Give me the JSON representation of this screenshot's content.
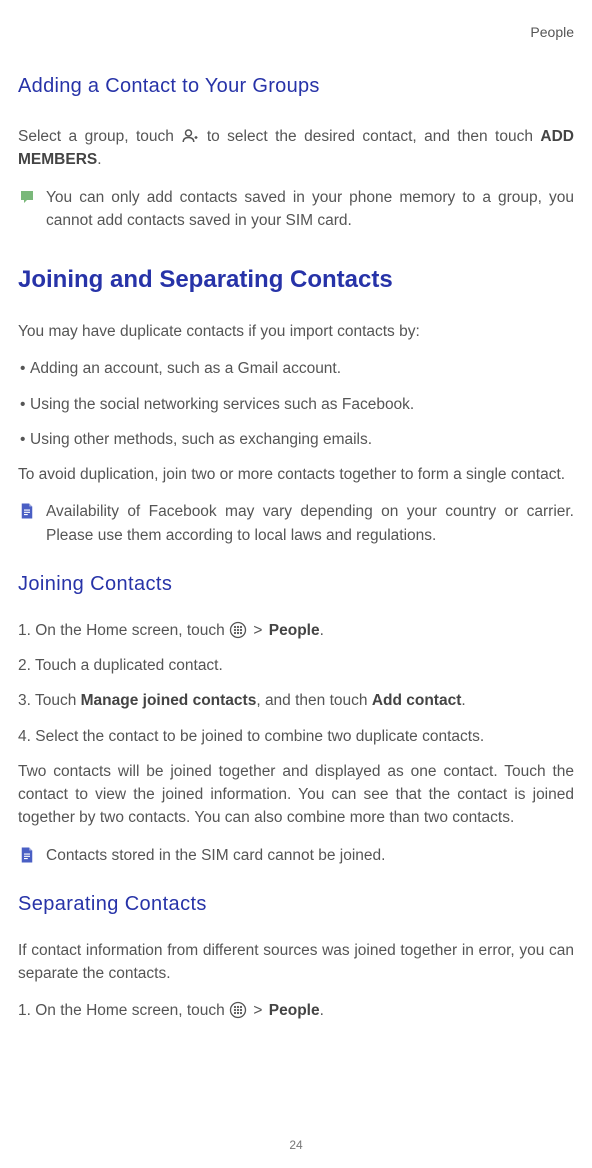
{
  "header": {
    "chapter": "People"
  },
  "section1": {
    "title": "Adding a Contact to Your Groups",
    "para1_a": "Select a group, touch ",
    "para1_b": " to select the desired contact, and then touch ",
    "para1_bold": "ADD MEMBERS",
    "para1_c": ".",
    "note1": "You can only add contacts saved in your phone memory to a group, you cannot add contacts saved in your SIM card."
  },
  "section2": {
    "title": "Joining and Separating Contacts",
    "intro": "You may have duplicate contacts if you import contacts by:",
    "bullets": [
      "Adding an account, such as a Gmail account.",
      "Using the social networking services such as Facebook.",
      "Using other methods, such as exchanging emails."
    ],
    "para2": "To avoid duplication, join two or more contacts together to form a single contact.",
    "note2": "Availability of Facebook may vary depending on your country or carrier. Please use them according to local laws and regulations."
  },
  "section3": {
    "title": "Joining Contacts",
    "step1_a": "On the Home screen, touch ",
    "step1_b": " > ",
    "step1_bold": "People",
    "step1_c": ".",
    "step2": "Touch a duplicated contact.",
    "step3_a": "Touch ",
    "step3_bold1": "Manage joined contacts",
    "step3_b": ", and then touch ",
    "step3_bold2": "Add contact",
    "step3_c": ".",
    "step4": "Select the contact to be joined to combine two duplicate contacts.",
    "para3": "Two contacts will be joined together and displayed as one contact. Touch the contact to view the joined information. You can see that the contact is joined together by two contacts. You can also combine more than two contacts.",
    "note3": "Contacts stored in the SIM card cannot be joined."
  },
  "section4": {
    "title": "Separating Contacts",
    "para4": "If contact information from different sources was joined together in error, you can separate the contacts.",
    "step1_a": "On the Home screen, touch ",
    "step1_b": " > ",
    "step1_bold": "People",
    "step1_c": "."
  },
  "pageNumber": "24"
}
